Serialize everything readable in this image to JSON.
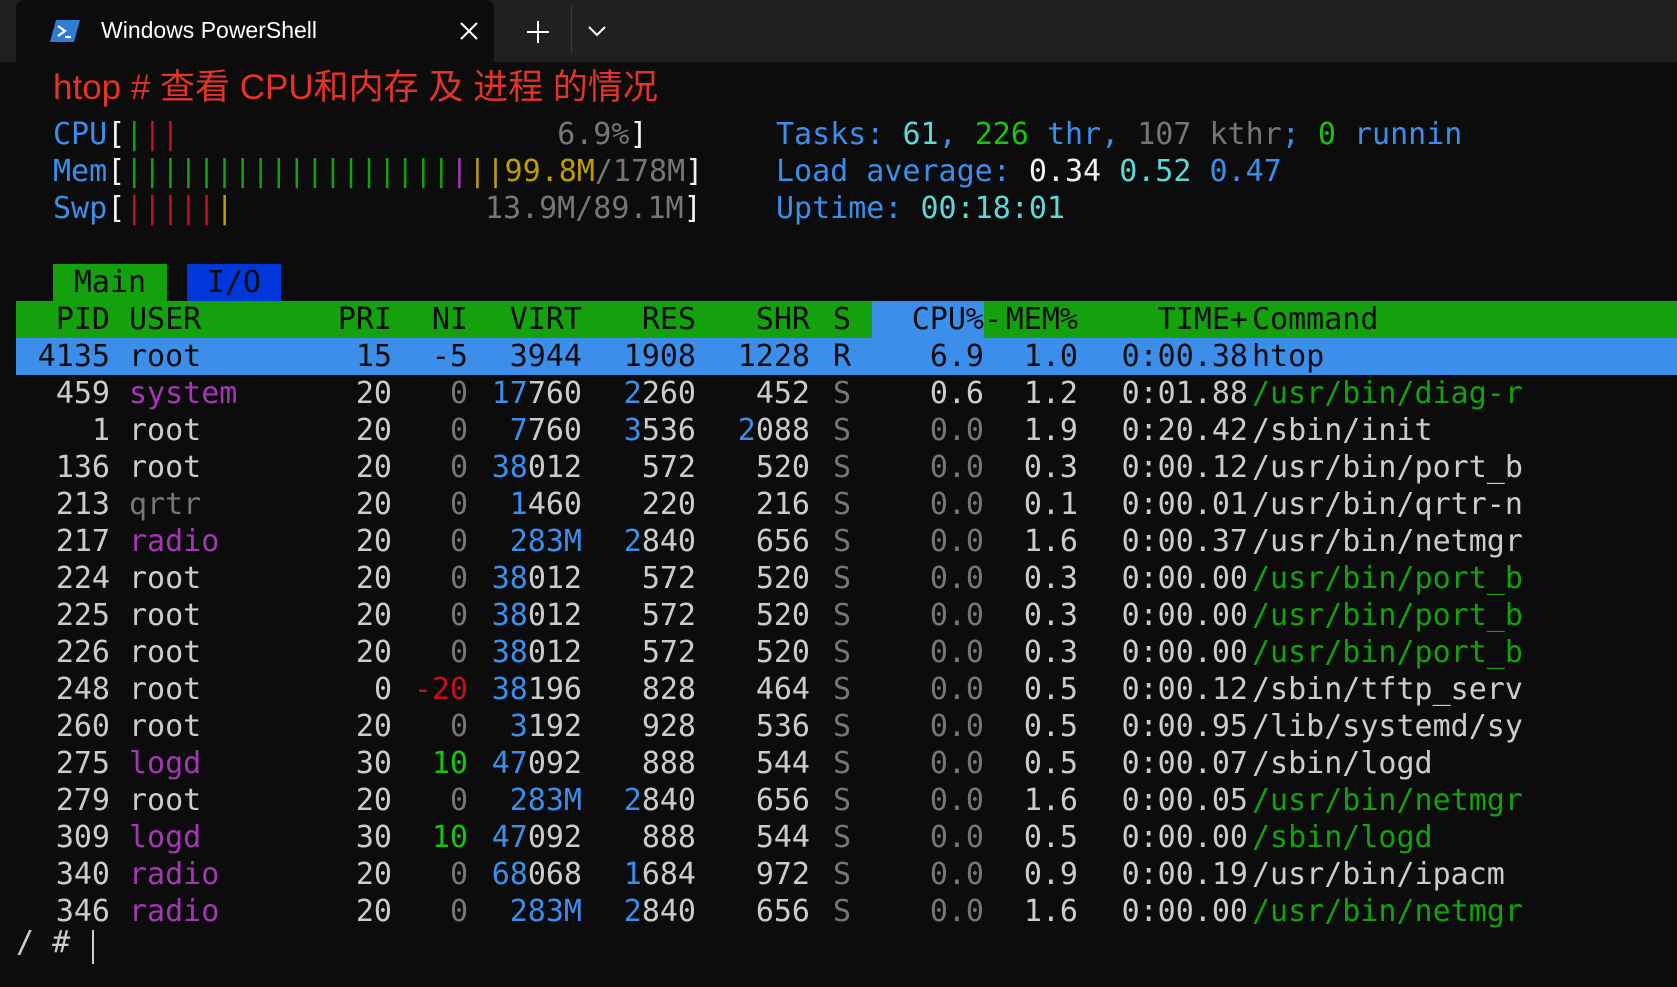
{
  "window": {
    "tab_title": "Windows PowerShell",
    "tab_icon": "powershell-icon",
    "close_icon": "close-icon",
    "new_tab_icon": "plus-icon",
    "dropdown_icon": "chevron-down-icon"
  },
  "terminal": {
    "command_line": "htop # 查看 CPU和内存 及 进程 的情况",
    "meters": {
      "cpu": {
        "label": "CPU",
        "open_bracket": "[",
        "bars_green": "|",
        "bars_red": "||",
        "value": "6.9%",
        "close_bracket": "]"
      },
      "mem": {
        "label": "Mem",
        "open_bracket": "[",
        "bars_green": "||||||||||||||||||",
        "bars_blue": "|",
        "bars_yellow": "||",
        "value_used": "99.8M",
        "value_sep": "/",
        "value_total": "178M",
        "close_bracket": "]"
      },
      "swp": {
        "label": "Swp",
        "open_bracket": "[",
        "bars_red": "|||||",
        "bars_yellow": "|",
        "value": "13.9M/89.1M",
        "close_bracket": "]"
      }
    },
    "stats": {
      "tasks_label": "Tasks:",
      "tasks_count": "61",
      "thr_count": "226",
      "thr_label": "thr",
      "kthr_count": "107",
      "kthr_label": "kthr",
      "running_count": "0",
      "running_label": "runnin",
      "load_label": "Load average:",
      "load_1": "0.34",
      "load_5": "0.52",
      "load_15": "0.47",
      "uptime_label": "Uptime:",
      "uptime_value": "00:18:01"
    },
    "screen_tabs": [
      "Main",
      "I/O"
    ],
    "columns": [
      "PID",
      "USER",
      "PRI",
      "NI",
      "VIRT",
      "RES",
      "SHR",
      "S",
      "CPU%",
      "MEM%",
      "TIME+",
      "Command"
    ],
    "processes": [
      {
        "pid": "4135",
        "user": "root",
        "pri": "15",
        "ni": "-5",
        "virt": "3944",
        "res": "1908",
        "shr": "1228",
        "s": "R",
        "cpu": "6.9",
        "mem": "1.0",
        "time": "0:00.38",
        "cmd": "htop"
      },
      {
        "pid": "459",
        "user": "system",
        "pri": "20",
        "ni": "0",
        "virt": "17760",
        "res": "2260",
        "shr": "452",
        "s": "S",
        "cpu": "0.6",
        "mem": "1.2",
        "time": "0:01.88",
        "cmd": "/usr/bin/diag-r"
      },
      {
        "pid": "1",
        "user": "root",
        "pri": "20",
        "ni": "0",
        "virt": "7760",
        "res": "3536",
        "shr": "2088",
        "s": "S",
        "cpu": "0.0",
        "mem": "1.9",
        "time": "0:20.42",
        "cmd": "/sbin/init"
      },
      {
        "pid": "136",
        "user": "root",
        "pri": "20",
        "ni": "0",
        "virt": "38012",
        "res": "572",
        "shr": "520",
        "s": "S",
        "cpu": "0.0",
        "mem": "0.3",
        "time": "0:00.12",
        "cmd": "/usr/bin/port_b"
      },
      {
        "pid": "213",
        "user": "qrtr",
        "pri": "20",
        "ni": "0",
        "virt": "1460",
        "res": "220",
        "shr": "216",
        "s": "S",
        "cpu": "0.0",
        "mem": "0.1",
        "time": "0:00.01",
        "cmd": "/usr/bin/qrtr-n"
      },
      {
        "pid": "217",
        "user": "radio",
        "pri": "20",
        "ni": "0",
        "virt": "283M",
        "res": "2840",
        "shr": "656",
        "s": "S",
        "cpu": "0.0",
        "mem": "1.6",
        "time": "0:00.37",
        "cmd": "/usr/bin/netmgr"
      },
      {
        "pid": "224",
        "user": "root",
        "pri": "20",
        "ni": "0",
        "virt": "38012",
        "res": "572",
        "shr": "520",
        "s": "S",
        "cpu": "0.0",
        "mem": "0.3",
        "time": "0:00.00",
        "cmd": "/usr/bin/port_b"
      },
      {
        "pid": "225",
        "user": "root",
        "pri": "20",
        "ni": "0",
        "virt": "38012",
        "res": "572",
        "shr": "520",
        "s": "S",
        "cpu": "0.0",
        "mem": "0.3",
        "time": "0:00.00",
        "cmd": "/usr/bin/port_b"
      },
      {
        "pid": "226",
        "user": "root",
        "pri": "20",
        "ni": "0",
        "virt": "38012",
        "res": "572",
        "shr": "520",
        "s": "S",
        "cpu": "0.0",
        "mem": "0.3",
        "time": "0:00.00",
        "cmd": "/usr/bin/port_b"
      },
      {
        "pid": "248",
        "user": "root",
        "pri": "0",
        "ni": "-20",
        "virt": "38196",
        "res": "828",
        "shr": "464",
        "s": "S",
        "cpu": "0.0",
        "mem": "0.5",
        "time": "0:00.12",
        "cmd": "/sbin/tftp_serv"
      },
      {
        "pid": "260",
        "user": "root",
        "pri": "20",
        "ni": "0",
        "virt": "3192",
        "res": "928",
        "shr": "536",
        "s": "S",
        "cpu": "0.0",
        "mem": "0.5",
        "time": "0:00.95",
        "cmd": "/lib/systemd/sy"
      },
      {
        "pid": "275",
        "user": "logd",
        "pri": "30",
        "ni": "10",
        "virt": "47092",
        "res": "888",
        "shr": "544",
        "s": "S",
        "cpu": "0.0",
        "mem": "0.5",
        "time": "0:00.07",
        "cmd": "/sbin/logd"
      },
      {
        "pid": "279",
        "user": "root",
        "pri": "20",
        "ni": "0",
        "virt": "283M",
        "res": "2840",
        "shr": "656",
        "s": "S",
        "cpu": "0.0",
        "mem": "1.6",
        "time": "0:00.05",
        "cmd": "/usr/bin/netmgr"
      },
      {
        "pid": "309",
        "user": "logd",
        "pri": "30",
        "ni": "10",
        "virt": "47092",
        "res": "888",
        "shr": "544",
        "s": "S",
        "cpu": "0.0",
        "mem": "0.5",
        "time": "0:00.00",
        "cmd": "/sbin/logd"
      },
      {
        "pid": "340",
        "user": "radio",
        "pri": "20",
        "ni": "0",
        "virt": "68068",
        "res": "1684",
        "shr": "972",
        "s": "S",
        "cpu": "0.0",
        "mem": "0.9",
        "time": "0:00.19",
        "cmd": "/usr/bin/ipacm"
      },
      {
        "pid": "346",
        "user": "radio",
        "pri": "20",
        "ni": "0",
        "virt": "283M",
        "res": "2840",
        "shr": "656",
        "s": "S",
        "cpu": "0.0",
        "mem": "1.6",
        "time": "0:00.00",
        "cmd": "/usr/bin/netmgr"
      }
    ],
    "prompt": "/ #"
  }
}
